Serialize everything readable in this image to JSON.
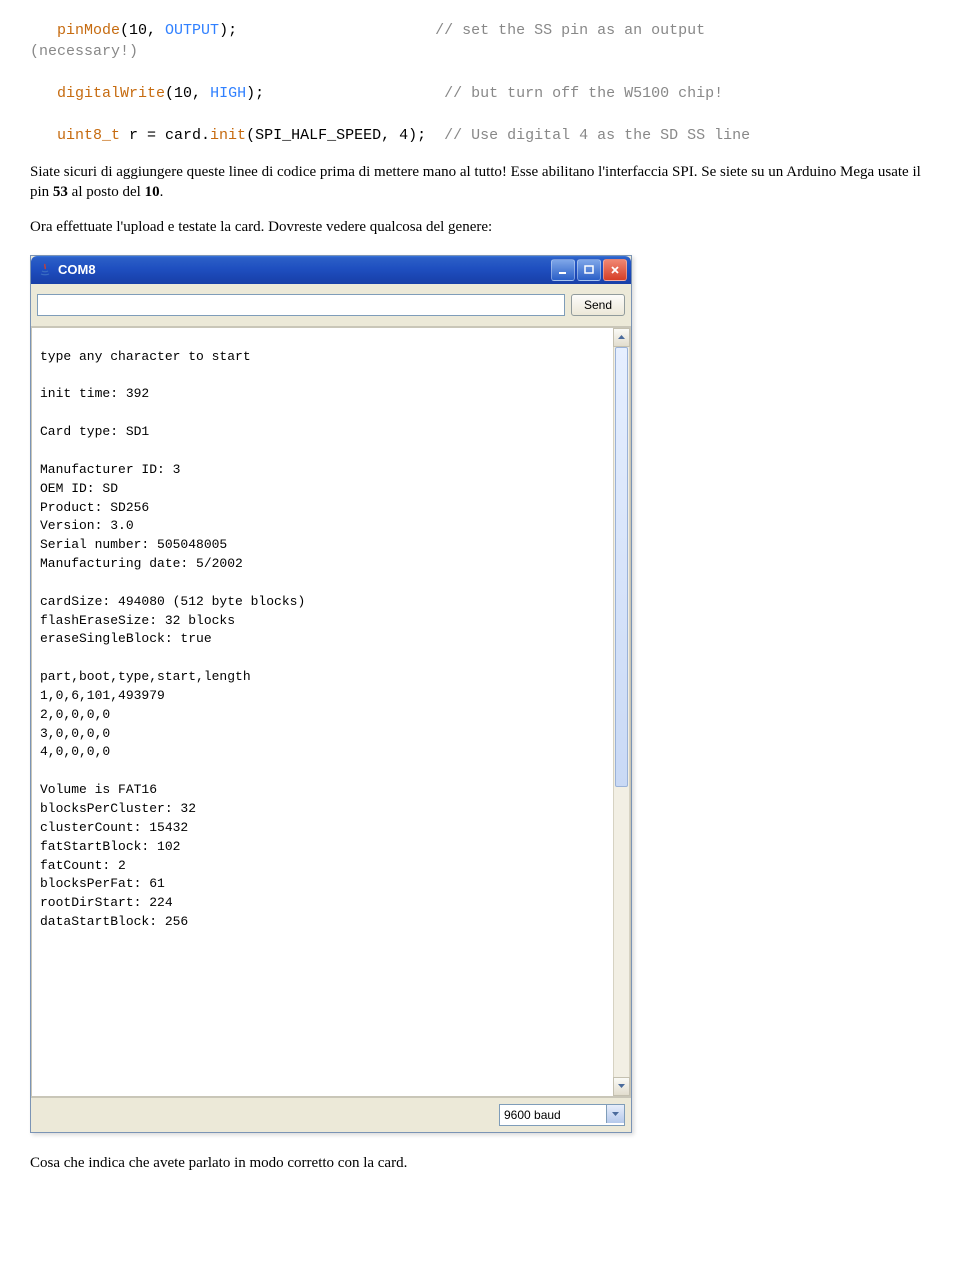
{
  "code": {
    "line1a": "pinMode",
    "line1b": "(10, ",
    "line1c": "OUTPUT",
    "line1d": ");",
    "line1comment": "// set the SS pin as an output",
    "line2": "(necessary!)",
    "line3a": "digitalWrite",
    "line3b": "(10, ",
    "line3c": "HIGH",
    "line3d": ");",
    "line3comment": "// but turn off the W5100 chip!",
    "line4a": "uint8_t",
    "line4b": " r = card.",
    "line4c": "init",
    "line4d": "(SPI_HALF_SPEED, 4);",
    "line4comment": "// Use digital 4 as the SD SS line"
  },
  "para1": "Siate sicuri di aggiungere queste linee di codice prima di mettere mano al tutto! Esse abilitano l'interfaccia SPI. Se siete su un Arduino Mega usate il pin ",
  "para1_b1": "53",
  "para1_mid": " al posto del ",
  "para1_b2": "10",
  "para1_end": ".",
  "para2": "Ora effettuate l'upload e testate la card. Dovreste vedere qualcosa del genere:",
  "window": {
    "title": "COM8",
    "send": "Send",
    "baud": "9600 baud",
    "input_value": ""
  },
  "terminal_text": "type any character to start\n\ninit time: 392\n\nCard type: SD1\n\nManufacturer ID: 3\nOEM ID: SD\nProduct: SD256\nVersion: 3.0\nSerial number: 505048005\nManufacturing date: 5/2002\n\ncardSize: 494080 (512 byte blocks)\nflashEraseSize: 32 blocks\neraseSingleBlock: true\n\npart,boot,type,start,length\n1,0,6,101,493979\n2,0,0,0,0\n3,0,0,0,0\n4,0,0,0,0\n\nVolume is FAT16\nblocksPerCluster: 32\nclusterCount: 15432\nfatStartBlock: 102\nfatCount: 2\nblocksPerFat: 61\nrootDirStart: 224\ndataStartBlock: 256",
  "para3": "Cosa che indica che avete parlato in modo corretto con la card."
}
